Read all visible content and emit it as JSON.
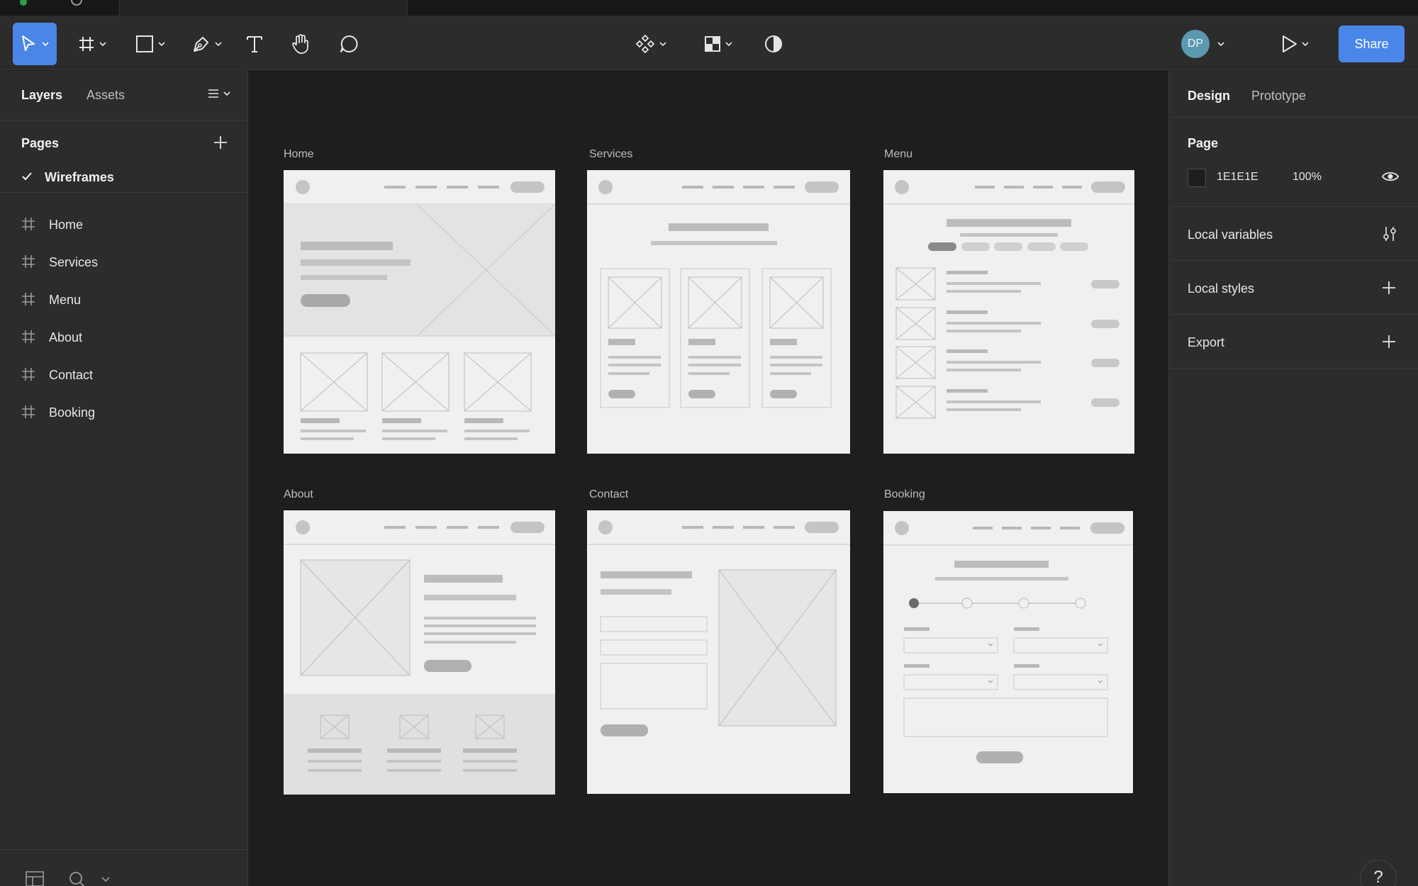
{
  "toolbar": {
    "share_label": "Share",
    "avatar_initials": "DP",
    "accent": "#4A86E8"
  },
  "left_panel": {
    "tabs": [
      "Layers",
      "Assets"
    ],
    "pages_header": "Pages",
    "current_page": "Wireframes",
    "layers": [
      "Home",
      "Services",
      "Menu",
      "About",
      "Contact",
      "Booking"
    ]
  },
  "canvas": {
    "frames": [
      "Home",
      "Services",
      "Menu",
      "About",
      "Contact",
      "Booking"
    ]
  },
  "right_panel": {
    "tabs": [
      "Design",
      "Prototype"
    ],
    "page_section": "Page",
    "page_color": "1E1E1E",
    "page_opacity": "100%",
    "local_variables": "Local variables",
    "local_styles": "Local styles",
    "export": "Export"
  },
  "help": "?"
}
